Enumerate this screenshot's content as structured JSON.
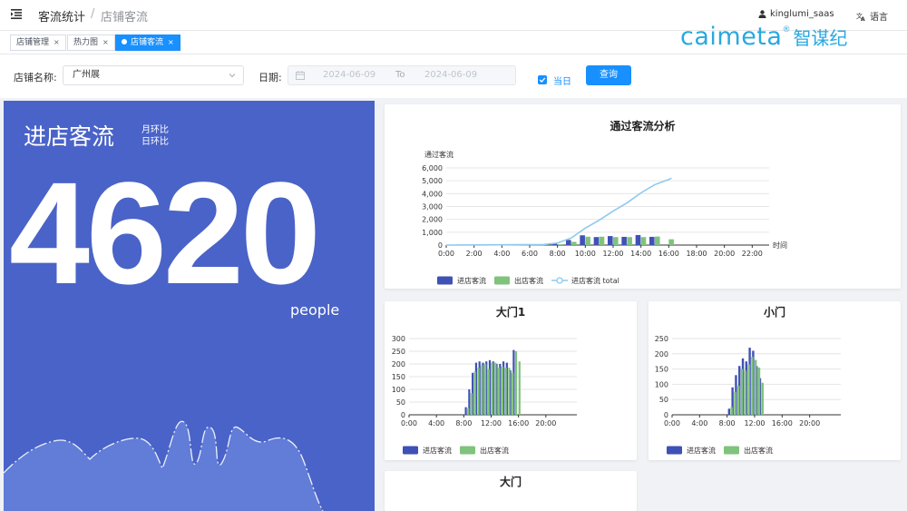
{
  "header": {
    "crumb_parent": "客流统计",
    "crumb_separator": "/",
    "crumb_current": "店铺客流",
    "username": "kinglumi_saas",
    "language_label": "语言"
  },
  "tags": [
    {
      "label": "店铺管理",
      "active": false
    },
    {
      "label": "热力图",
      "active": false
    },
    {
      "label": "店铺客流",
      "active": true
    }
  ],
  "tag_close": "×",
  "logo": {
    "en": "caimeta",
    "reg": "®",
    "cn": "智谋纪"
  },
  "filters": {
    "store_label": "店铺名称:",
    "store_value": "广州展",
    "date_label": "日期:",
    "date_start": "2024-06-09",
    "date_to": "To",
    "date_end": "2024-06-09",
    "today_label": "当日",
    "today_checked": true,
    "query_button": "查询"
  },
  "summary": {
    "title": "进店客流",
    "compare_month": "月环比",
    "compare_day": "日环比",
    "value": "4620",
    "unit": "people"
  },
  "colors": {
    "in": "#3f51b5",
    "out": "#7fc37c",
    "total": "#8ec9ee",
    "panel": "#4a63c8"
  },
  "chart_data": [
    {
      "type": "bar",
      "title": "通过客流分析",
      "ylabel": "通过客流",
      "xlabel": "时间",
      "ylim": [
        0,
        6000
      ],
      "yticks": [
        "0",
        "1,000",
        "2,000",
        "3,000",
        "4,000",
        "5,000",
        "6,000"
      ],
      "xticks": [
        "0:00",
        "2:00",
        "4:00",
        "6:00",
        "8:00",
        "10:00",
        "12:00",
        "14:00",
        "16:00",
        "18:00",
        "20:00",
        "22:00"
      ],
      "x": [
        7,
        8,
        9,
        10,
        11,
        12,
        13,
        14,
        15,
        16
      ],
      "series": [
        {
          "name": "进店客流",
          "kind": "bar",
          "values": [
            40,
            120,
            400,
            760,
            620,
            700,
            640,
            780,
            640,
            0
          ]
        },
        {
          "name": "出店客流",
          "kind": "bar",
          "values": [
            20,
            60,
            250,
            650,
            650,
            620,
            620,
            620,
            660,
            450
          ]
        },
        {
          "name": "进店客流 total",
          "kind": "line",
          "x": [
            0,
            7,
            8,
            9,
            10,
            11,
            12,
            13,
            14,
            15,
            16,
            16.2
          ],
          "values": [
            0,
            40,
            160,
            560,
            1320,
            1940,
            2640,
            3280,
            4060,
            4700,
            5100,
            5200
          ]
        }
      ],
      "legend": "bottom"
    },
    {
      "type": "bar",
      "title": "大门1",
      "ylim": [
        0,
        300
      ],
      "yticks": [
        "0",
        "50",
        "100",
        "150",
        "200",
        "250",
        "300"
      ],
      "xticks": [
        "0:00",
        "4:00",
        "8:00",
        "12:00",
        "16:00",
        "20:00"
      ],
      "x": [
        8.5,
        9,
        9.5,
        10,
        10.5,
        11,
        11.5,
        12,
        12.5,
        13,
        13.5,
        14,
        14.5,
        15,
        15.5,
        16,
        16.5,
        17.5
      ],
      "series": [
        {
          "name": "进店客流",
          "values": [
            30,
            100,
            165,
            205,
            210,
            205,
            210,
            215,
            210,
            200,
            200,
            210,
            205,
            175,
            255,
            0,
            0,
            0
          ]
        },
        {
          "name": "出店客流",
          "values": [
            25,
            85,
            170,
            185,
            195,
            200,
            180,
            205,
            205,
            185,
            190,
            185,
            185,
            165,
            250,
            210,
            0,
            0
          ]
        }
      ],
      "legend": "bottom"
    },
    {
      "type": "bar",
      "title": "小门",
      "ylim": [
        0,
        250
      ],
      "yticks": [
        "0",
        "50",
        "100",
        "150",
        "200",
        "250"
      ],
      "xticks": [
        "0:00",
        "4:00",
        "8:00",
        "12:00",
        "16:00",
        "20:00"
      ],
      "x": [
        8.5,
        9,
        9.5,
        10,
        10.5,
        11,
        11.5,
        12,
        12.5,
        13,
        13.5,
        14,
        14.5,
        15,
        15.5,
        16
      ],
      "series": [
        {
          "name": "进店客流",
          "values": [
            20,
            90,
            130,
            160,
            185,
            175,
            220,
            210,
            160,
            120,
            0,
            0,
            0,
            0,
            0,
            0
          ]
        },
        {
          "name": "出店客流",
          "values": [
            25,
            75,
            95,
            150,
            145,
            165,
            190,
            180,
            155,
            105,
            0,
            0,
            0,
            0,
            0,
            0
          ]
        }
      ],
      "legend": "bottom"
    },
    {
      "type": "bar",
      "title": "大门",
      "series": []
    }
  ]
}
